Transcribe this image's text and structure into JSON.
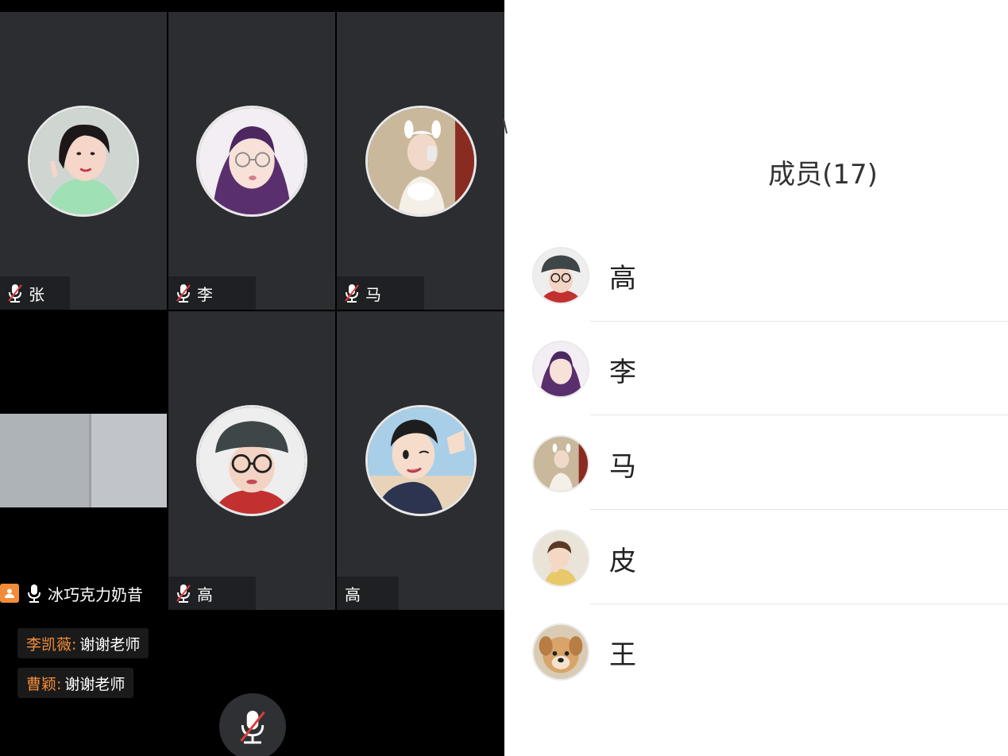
{
  "meeting": {
    "grid": [
      {
        "name": "张",
        "muted": true,
        "avatar": "girl-peace-sign-avatar"
      },
      {
        "name": "李",
        "muted": true,
        "avatar": "girl-glasses-purple-hair-avatar"
      },
      {
        "name": "马",
        "muted": true,
        "avatar": "girl-bunny-headband-cat-avatar"
      },
      {
        "name": "冰巧克力奶昔",
        "muted": false,
        "has_video": true,
        "is_self_badge": "person-icon"
      },
      {
        "name": "高",
        "muted": true,
        "avatar": "girl-bucket-hat-glasses-avatar"
      },
      {
        "name": "高",
        "muted": false,
        "avatar": "anime-boy-wink-avatar"
      }
    ],
    "chat": [
      {
        "sender": "李凯薇:",
        "text": "谢谢老师"
      },
      {
        "sender": "曹颖:",
        "text": "谢谢老师"
      }
    ],
    "mic_button_icon": "mic-muted-icon"
  },
  "members": {
    "title": "成员(17)",
    "list": [
      {
        "name": "高",
        "avatar": "girl-bucket-hat-glasses-avatar"
      },
      {
        "name": "李",
        "avatar": "girl-glasses-purple-hair-avatar"
      },
      {
        "name": "马",
        "avatar": "girl-bunny-headband-cat-avatar"
      },
      {
        "name": "皮",
        "avatar": "toddler-girl-avatar"
      },
      {
        "name": "王",
        "avatar": "puppy-avatar"
      }
    ]
  },
  "colors": {
    "tile_bg": "#2b2d31",
    "name_tag_bg": "#1f2023",
    "accent_orange": "#f08c3a",
    "muted_red": "#e23b3b",
    "panel_bg": "#ffffff"
  }
}
